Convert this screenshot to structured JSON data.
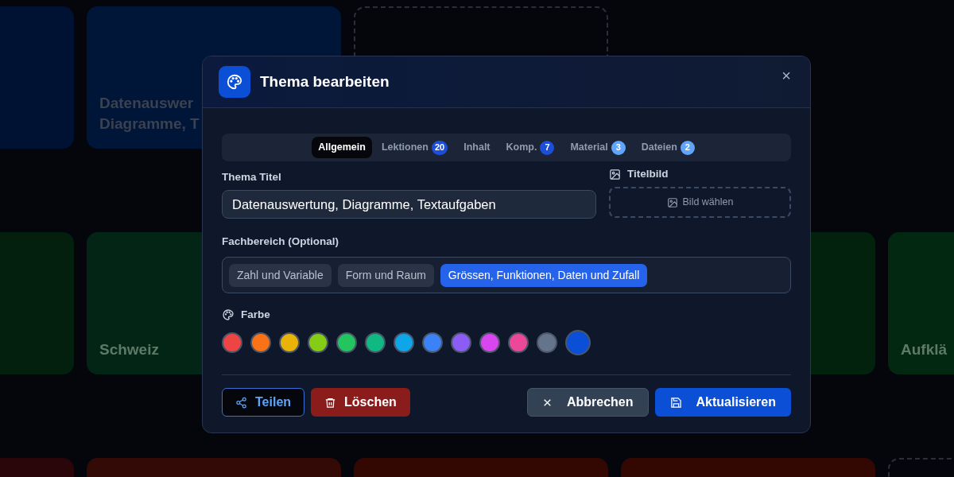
{
  "background_cards": [
    {
      "kind": "filled",
      "color": "#001233"
    },
    {
      "kind": "filled",
      "color": "#001638",
      "lines": [
        "Datenauswer",
        "Diagramme, T"
      ]
    },
    {
      "kind": "empty"
    },
    {
      "kind": "none"
    },
    {
      "kind": "none"
    },
    {
      "kind": "filled",
      "color": "#03200e"
    },
    {
      "kind": "filled",
      "color": "#032516",
      "lines": [
        "Schweiz"
      ]
    },
    {
      "kind": "none"
    },
    {
      "kind": "filled",
      "color": "#03220e"
    },
    {
      "kind": "filled",
      "color": "#032812",
      "lines": [
        "Aufklä"
      ]
    },
    {
      "kind": "filled",
      "color": "#2a050a"
    },
    {
      "kind": "filled",
      "color": "#330a05"
    },
    {
      "kind": "filled",
      "color": "#330803"
    },
    {
      "kind": "filled",
      "color": "#330803"
    },
    {
      "kind": "empty"
    }
  ],
  "dialog": {
    "title": "Thema bearbeiten",
    "close": "×",
    "tabs": [
      {
        "label": "Allgemein",
        "selected": true
      },
      {
        "label": "Lektionen",
        "badge": {
          "text": "20",
          "color": "#1d4ed8"
        },
        "selected": false
      },
      {
        "label": "Inhalt",
        "selected": false
      },
      {
        "label": "Komp.",
        "badge": {
          "text": "7",
          "color": "#1d4ed8"
        },
        "selected": false
      },
      {
        "label": "Material",
        "badge": {
          "text": "3",
          "color": "#60a5fa"
        },
        "selected": false
      },
      {
        "label": "Dateien",
        "badge": {
          "text": "2",
          "color": "#60a5fa"
        },
        "selected": false
      }
    ],
    "title_field": {
      "label": "Thema Titel",
      "value": "Datenauswertung, Diagramme, Textaufgaben"
    },
    "cover_image": {
      "label": "Titelbild",
      "button": "Bild wählen"
    },
    "subject_area": {
      "label": "Fachbereich (Optional)",
      "options": [
        {
          "label": "Zahl und Variable",
          "selected": false
        },
        {
          "label": "Form und Raum",
          "selected": false
        },
        {
          "label": "Grössen, Funktionen, Daten und Zufall",
          "selected": true
        }
      ]
    },
    "color_picker": {
      "label": "Farbe",
      "swatches": [
        {
          "color": "#ef4444",
          "selected": false
        },
        {
          "color": "#f97316",
          "selected": false
        },
        {
          "color": "#eab308",
          "selected": false
        },
        {
          "color": "#84cc16",
          "selected": false
        },
        {
          "color": "#22c55e",
          "selected": false
        },
        {
          "color": "#10b981",
          "selected": false
        },
        {
          "color": "#0ea5e9",
          "selected": false
        },
        {
          "color": "#3b82f6",
          "selected": false
        },
        {
          "color": "#8b5cf6",
          "selected": false
        },
        {
          "color": "#d946ef",
          "selected": false
        },
        {
          "color": "#ec4899",
          "selected": false
        },
        {
          "color": "#64748b",
          "selected": false
        },
        {
          "color": "#0b4fd6",
          "selected": true
        }
      ]
    },
    "buttons": [
      {
        "kind": "share",
        "label": "Teilen"
      },
      {
        "kind": "delete",
        "label": "Löschen"
      },
      {
        "kind": "cancel",
        "label": "Abbrechen"
      },
      {
        "kind": "save",
        "label": "Aktualisieren"
      }
    ]
  }
}
